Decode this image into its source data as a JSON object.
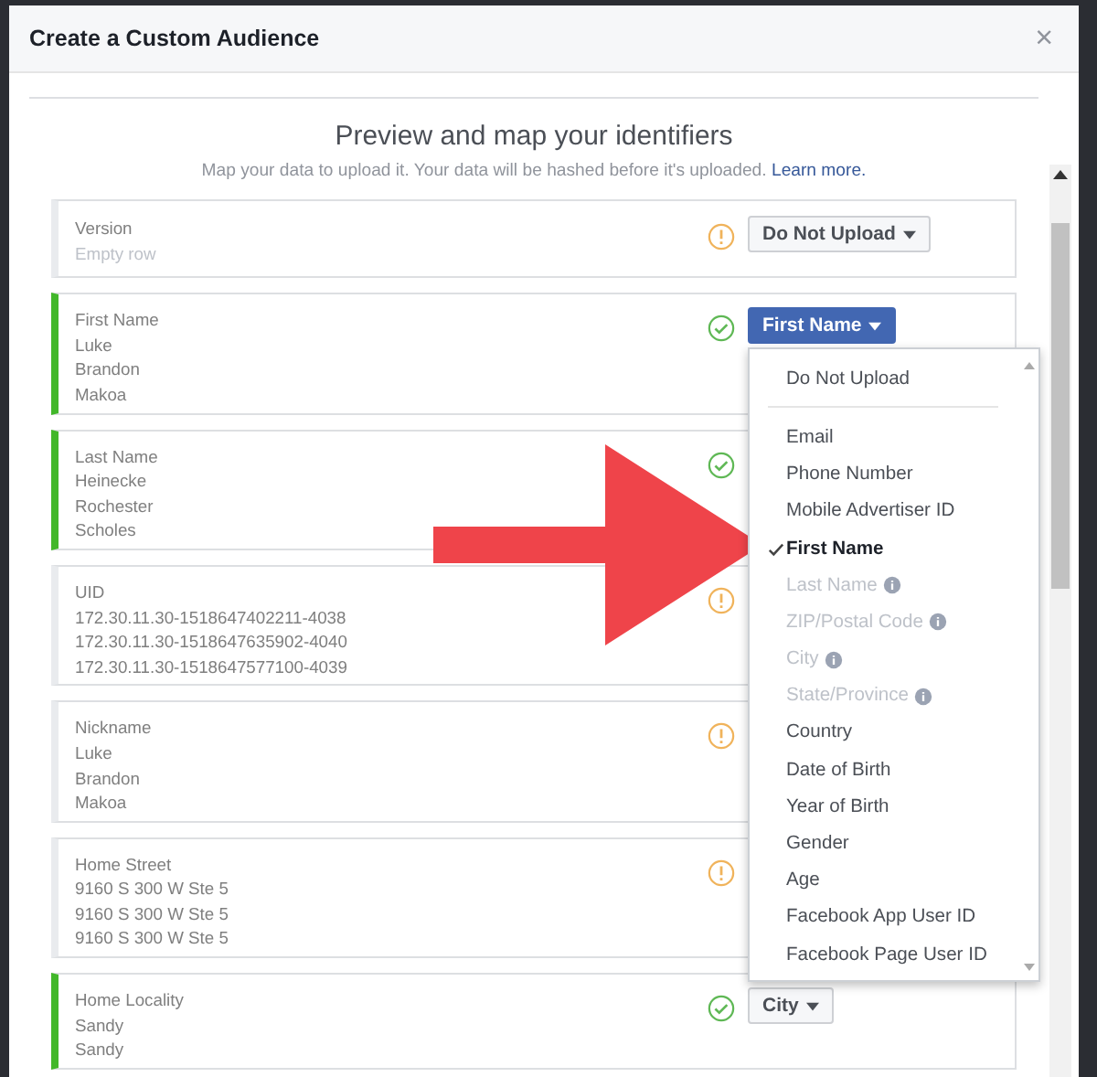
{
  "dialog": {
    "title": "Create a Custom Audience",
    "close": "×"
  },
  "heading": "Preview and map your identifiers",
  "subtitle": "Map your data to upload it. Your data will be hashed before it's uploaded.",
  "learn_more": "Learn more.",
  "rows": [
    {
      "lines": [
        "Version",
        "Empty row"
      ],
      "mapped": false,
      "empty": true,
      "mapping": "Do Not Upload",
      "open": false
    },
    {
      "lines": [
        "First Name",
        "Luke",
        "Brandon",
        "Makoa"
      ],
      "mapped": true,
      "empty": false,
      "mapping": "First Name",
      "open": true
    },
    {
      "lines": [
        "Last Name",
        "Heinecke",
        "Rochester",
        "Scholes"
      ],
      "mapped": true,
      "empty": false
    },
    {
      "lines": [
        "UID",
        "172.30.11.30-1518647402211-4038",
        "172.30.11.30-1518647635902-4040",
        "172.30.11.30-1518647577100-4039"
      ],
      "mapped": false,
      "empty": false
    },
    {
      "lines": [
        "Nickname",
        "Luke",
        "Brandon",
        "Makoa"
      ],
      "mapped": false,
      "empty": false
    },
    {
      "lines": [
        "Home Street",
        "9160 S 300 W Ste 5",
        "9160 S 300 W Ste 5",
        "9160 S 300 W Ste 5"
      ],
      "mapped": false,
      "empty": false
    },
    {
      "lines": [
        "Home Locality",
        "Sandy",
        "Sandy"
      ],
      "mapped": true,
      "empty": false,
      "mapping": "City",
      "open": false
    }
  ],
  "menu": [
    {
      "kind": "option",
      "label": "Do Not Upload",
      "selected": false,
      "disabled": false
    },
    {
      "kind": "divider"
    },
    {
      "kind": "option",
      "label": "Email",
      "selected": false,
      "disabled": false
    },
    {
      "kind": "option",
      "label": "Phone Number",
      "selected": false,
      "disabled": false
    },
    {
      "kind": "option",
      "label": "Mobile Advertiser ID",
      "selected": false,
      "disabled": false
    },
    {
      "kind": "option",
      "label": "First Name",
      "selected": true,
      "disabled": false
    },
    {
      "kind": "option",
      "label": "Last Name",
      "selected": false,
      "disabled": true
    },
    {
      "kind": "option",
      "label": "ZIP/Postal Code",
      "selected": false,
      "disabled": true
    },
    {
      "kind": "option",
      "label": "City",
      "selected": false,
      "disabled": true
    },
    {
      "kind": "option",
      "label": "State/Province",
      "selected": false,
      "disabled": true
    },
    {
      "kind": "option",
      "label": "Country",
      "selected": false,
      "disabled": false
    },
    {
      "kind": "option",
      "label": "Date of Birth",
      "selected": false,
      "disabled": false
    },
    {
      "kind": "option",
      "label": "Year of Birth",
      "selected": false,
      "disabled": false
    },
    {
      "kind": "option",
      "label": "Gender",
      "selected": false,
      "disabled": false
    },
    {
      "kind": "option",
      "label": "Age",
      "selected": false,
      "disabled": false
    },
    {
      "kind": "option",
      "label": "Facebook App User ID",
      "selected": false,
      "disabled": false
    },
    {
      "kind": "option",
      "label": "Facebook Page User ID",
      "selected": false,
      "disabled": false
    }
  ]
}
